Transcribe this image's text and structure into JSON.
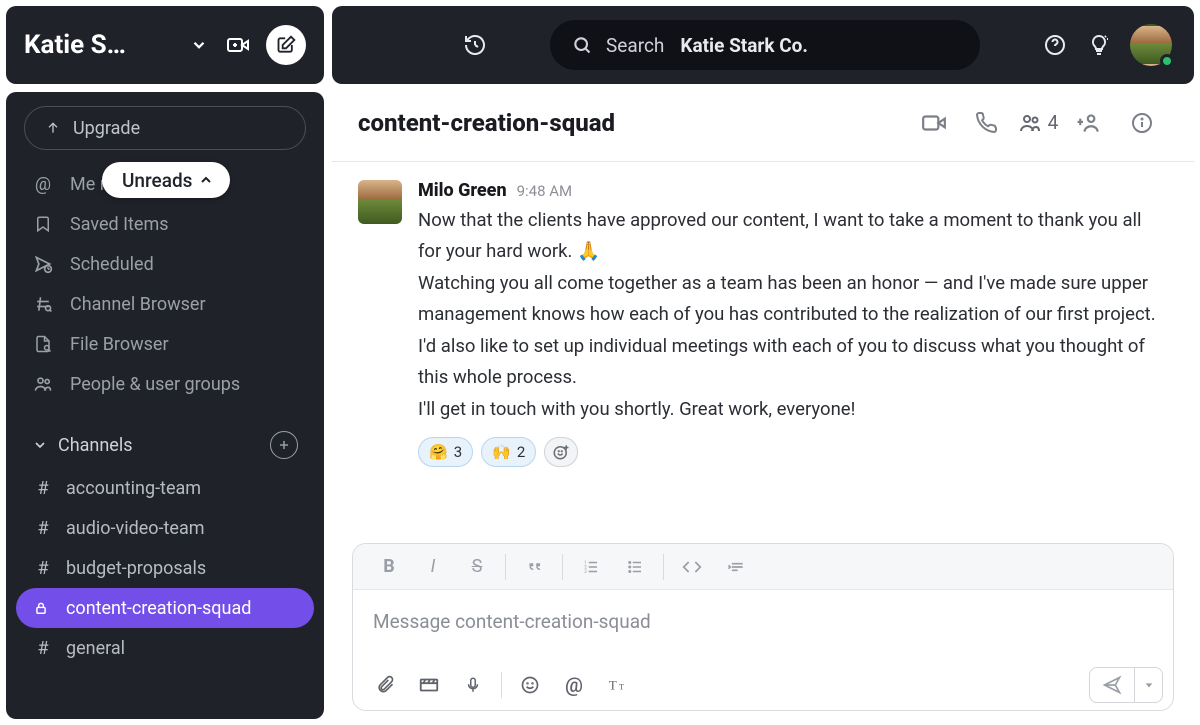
{
  "workspace": {
    "name": "Katie S…"
  },
  "sidebar": {
    "upgrade": "Upgrade",
    "unreads_pill": "Unreads",
    "nav": [
      {
        "label": "Mentions & Reactions",
        "display": "Me                ns"
      },
      {
        "label": "Saved Items"
      },
      {
        "label": "Scheduled"
      },
      {
        "label": "Channel Browser"
      },
      {
        "label": "File Browser"
      },
      {
        "label": "People & user groups"
      }
    ],
    "channels_header": "Channels",
    "channels": [
      {
        "name": "accounting-team",
        "locked": false,
        "active": false
      },
      {
        "name": "audio-video-team",
        "locked": false,
        "active": false
      },
      {
        "name": "budget-proposals",
        "locked": false,
        "active": false
      },
      {
        "name": "content-creation-squad",
        "locked": true,
        "active": true
      },
      {
        "name": "general",
        "locked": false,
        "active": false
      }
    ]
  },
  "topbar": {
    "search_prefix": "Search",
    "search_scope": "Katie Stark Co."
  },
  "channel": {
    "title": "content-creation-squad",
    "member_count": "4"
  },
  "message": {
    "author": "Milo Green",
    "time": "9:48 AM",
    "p1a": "Now that the clients have approved our content, I want to take a moment to thank you all for your hard work. ",
    "p1_emoji": "🙏",
    "p2": "Watching you all come together as a team has been an honor — and I've made sure upper management knows how each of you has contributed to the realization of our first project.",
    "p3": "I'd also like to set up individual meetings with each of you to discuss what you thought of this whole process.",
    "p4": "I'll get in touch with you shortly. Great work, everyone!",
    "reactions": [
      {
        "emoji": "🤗",
        "count": "3"
      },
      {
        "emoji": "🙌",
        "count": "2"
      }
    ]
  },
  "composer": {
    "placeholder": "Message content-creation-squad"
  }
}
